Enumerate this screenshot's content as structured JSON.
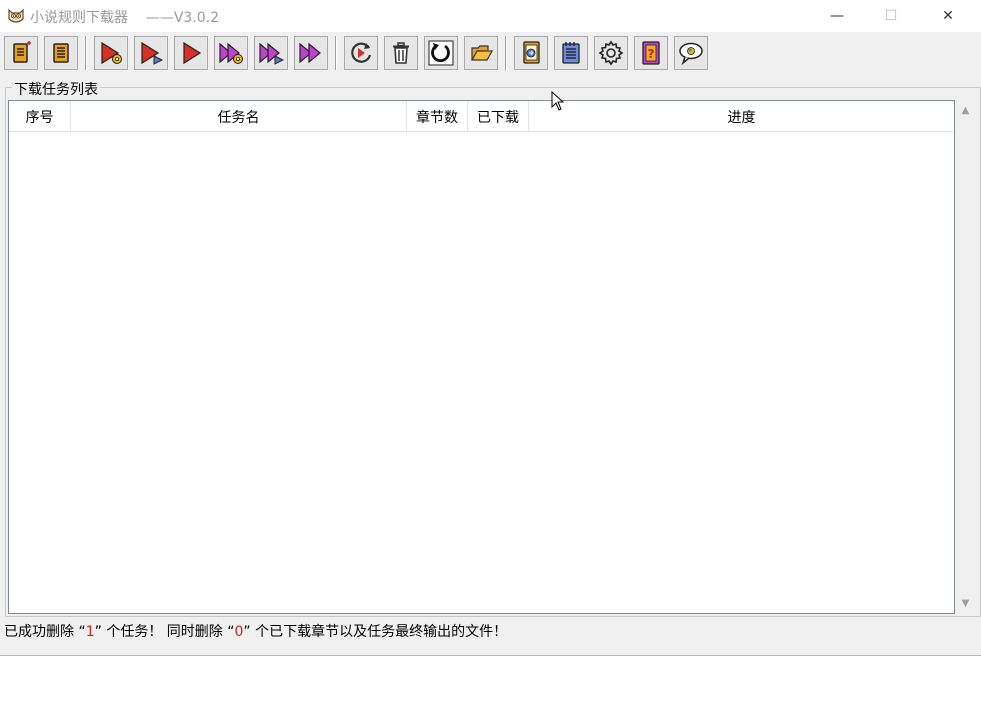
{
  "window": {
    "title": "小说规则下载器",
    "version": "——V3.0.2",
    "min_glyph": "—",
    "max_glyph": "☐",
    "close_glyph": "✕"
  },
  "toolbar": {
    "buttons": [
      {
        "icon": "new-rule-book-icon"
      },
      {
        "icon": "rule-book-icon"
      },
      {
        "icon": "play-settings-icon"
      },
      {
        "icon": "play-next-icon"
      },
      {
        "icon": "play-icon"
      },
      {
        "icon": "fast-forward-settings-icon"
      },
      {
        "icon": "fast-forward-next-icon"
      },
      {
        "icon": "fast-forward-icon"
      },
      {
        "icon": "resume-icon"
      },
      {
        "icon": "trash-icon"
      },
      {
        "icon": "refresh-icon"
      },
      {
        "icon": "open-folder-icon"
      },
      {
        "icon": "export-document-icon"
      },
      {
        "icon": "notepad-icon"
      },
      {
        "icon": "gear-icon"
      },
      {
        "icon": "help-book-icon"
      },
      {
        "icon": "feedback-bubble-icon"
      }
    ]
  },
  "task_list": {
    "group_label": "下载任务列表",
    "columns": [
      "序号",
      "任务名",
      "章节数",
      "已下载",
      "进度"
    ],
    "rows": []
  },
  "status": {
    "prefix": "已成功删除 “",
    "deleted_tasks": "1",
    "middle": "” 个任务！ 同时删除 “",
    "deleted_chapters": "0",
    "suffix": "” 个已下载章节以及任务最终输出的文件！"
  },
  "scrollbar": {
    "up": "▲",
    "down": "▼"
  },
  "colors": {
    "status_number": "#cc2222"
  }
}
